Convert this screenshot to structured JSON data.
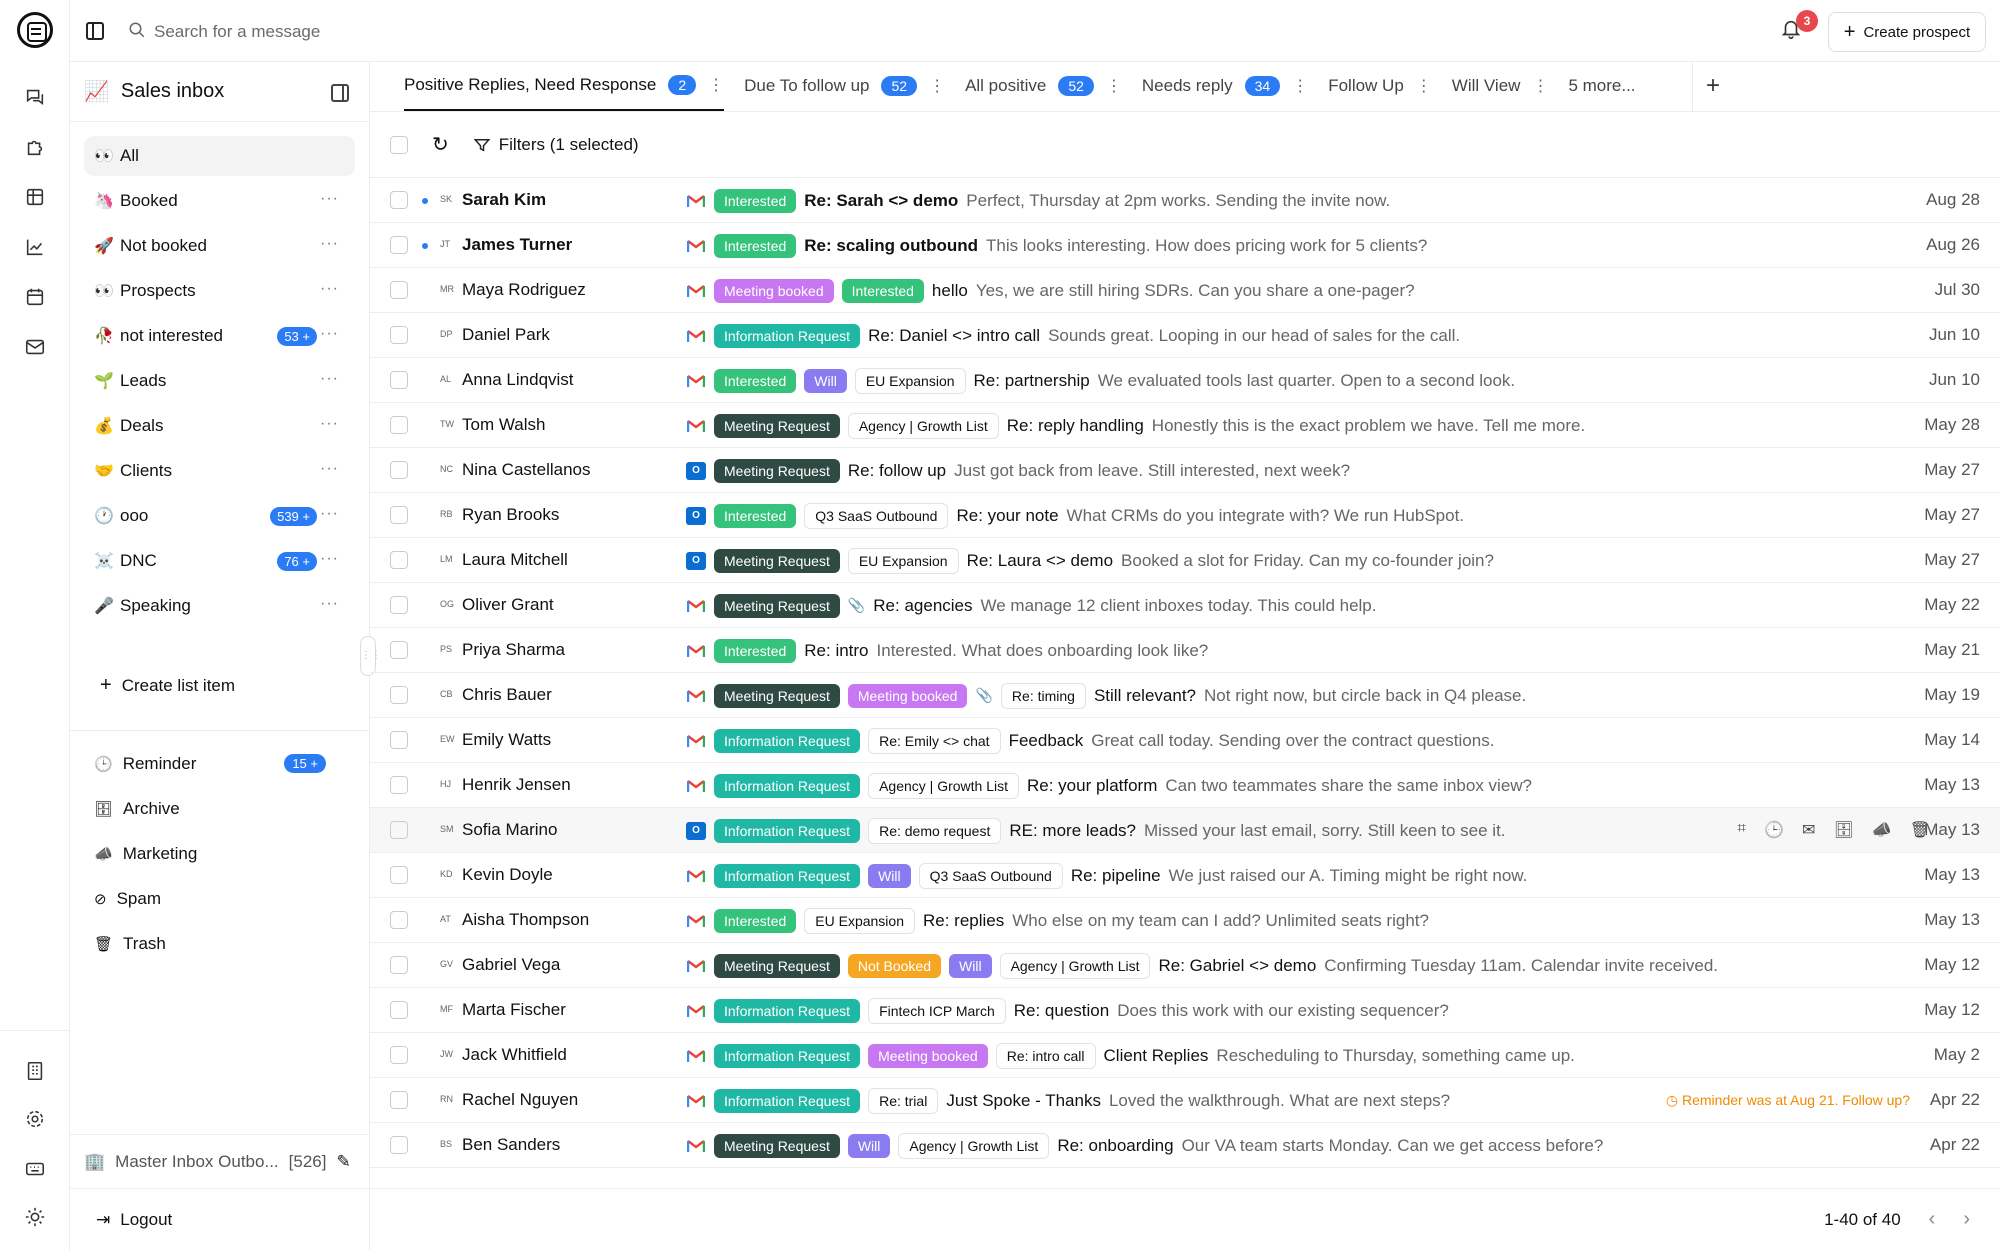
{
  "topbar": {
    "search_placeholder": "Search for a message",
    "notification_count": "3",
    "create_prospect": "Create prospect"
  },
  "sidebar": {
    "title": "Sales inbox",
    "title_emoji": "📈",
    "items": [
      {
        "emoji": "👀",
        "label": "All",
        "count": ""
      },
      {
        "emoji": "🦄",
        "label": "Booked",
        "count": ""
      },
      {
        "emoji": "🚀",
        "label": "Not booked",
        "count": ""
      },
      {
        "emoji": "👀",
        "label": "Prospects",
        "count": ""
      },
      {
        "emoji": "🥀",
        "label": "not interested",
        "count": "53 +"
      },
      {
        "emoji": "🌱",
        "label": "Leads",
        "count": ""
      },
      {
        "emoji": "💰",
        "label": "Deals",
        "count": ""
      },
      {
        "emoji": "🤝",
        "label": "Clients",
        "count": ""
      },
      {
        "emoji": "🕐",
        "label": "ooo",
        "count": "539 +"
      },
      {
        "emoji": "☠️",
        "label": "DNC",
        "count": "76 +"
      },
      {
        "emoji": "🎤",
        "label": "Speaking",
        "count": ""
      }
    ],
    "create_list_item": "Create list item",
    "bottom": [
      {
        "icon": "clock-icon",
        "label": "Reminder",
        "count": "15 +"
      },
      {
        "icon": "archive-icon",
        "label": "Archive",
        "count": ""
      },
      {
        "icon": "megaphone-icon",
        "label": "Marketing",
        "count": ""
      },
      {
        "icon": "spam-icon",
        "label": "Spam",
        "count": ""
      },
      {
        "icon": "trash-icon",
        "label": "Trash",
        "count": ""
      }
    ],
    "master_inbox": "Master Inbox Outbo...",
    "master_count": "[526]",
    "logout": "Logout"
  },
  "tabs": [
    {
      "label": "Positive Replies, Need Response",
      "count": "2"
    },
    {
      "label": "Due To follow up",
      "count": "52"
    },
    {
      "label": "All positive",
      "count": "52"
    },
    {
      "label": "Needs reply",
      "count": "34"
    },
    {
      "label": "Follow Up",
      "count": ""
    },
    {
      "label": "Will View",
      "count": ""
    },
    {
      "label": "5 more...",
      "count": ""
    }
  ],
  "toolbar": {
    "filters": "Filters (1 selected)"
  },
  "rows": [
    {
      "ini": "SK",
      "name": "Sarah Kim",
      "unread": true,
      "prov": "gm",
      "tags": [
        [
          "int",
          "Interested"
        ]
      ],
      "labels": [],
      "subject": "Re: Sarah <> demo",
      "preview": "Perfect, Thursday at 2pm works. Sending the invite now.",
      "date": "Aug 28"
    },
    {
      "ini": "JT",
      "name": "James Turner",
      "unread": true,
      "prov": "gm",
      "tags": [
        [
          "int",
          "Interested"
        ]
      ],
      "labels": [],
      "subject": "Re: scaling outbound",
      "preview": "This looks interesting. How does pricing work for 5 clients?",
      "date": "Aug 26"
    },
    {
      "ini": "MR",
      "name": "Maya Rodriguez",
      "unread": false,
      "prov": "gm",
      "tags": [
        [
          "mb",
          "Meeting booked"
        ],
        [
          "int",
          "Interested"
        ]
      ],
      "labels": [],
      "subject": "hello",
      "preview": "Yes, we are still hiring SDRs. Can you share a one-pager?",
      "date": "Jul 30"
    },
    {
      "ini": "DP",
      "name": "Daniel Park",
      "unread": false,
      "prov": "gm",
      "tags": [
        [
          "ir",
          "Information Request"
        ]
      ],
      "labels": [],
      "subject": "Re: Daniel <> intro call",
      "preview": "Sounds great. Looping in our head of sales for the call.",
      "date": "Jun 10"
    },
    {
      "ini": "AL",
      "name": "Anna Lindqvist",
      "unread": false,
      "prov": "gm",
      "tags": [
        [
          "int",
          "Interested"
        ],
        [
          "will",
          "Will"
        ]
      ],
      "labels": [
        "EU Expansion"
      ],
      "subject": "Re: partnership",
      "preview": "We evaluated tools last quarter. Open to a second look.",
      "date": "Jun 10"
    },
    {
      "ini": "TW",
      "name": "Tom Walsh",
      "unread": false,
      "prov": "gm",
      "tags": [
        [
          "mr",
          "Meeting Request"
        ]
      ],
      "labels": [
        "Agency | Growth List"
      ],
      "subject": "Re: reply handling",
      "preview": "Honestly this is the exact problem we have. Tell me more.",
      "date": "May 28"
    },
    {
      "ini": "NC",
      "name": "Nina Castellanos",
      "unread": false,
      "prov": "ol",
      "tags": [
        [
          "mr",
          "Meeting Request"
        ]
      ],
      "labels": [],
      "subject": "Re: follow up",
      "preview": "Just got back from leave. Still interested, next week?",
      "date": "May 27"
    },
    {
      "ini": "RB",
      "name": "Ryan Brooks",
      "unread": false,
      "prov": "ol",
      "tags": [
        [
          "int",
          "Interested"
        ]
      ],
      "labels": [
        "Q3 SaaS Outbound"
      ],
      "subject": "Re: your note",
      "preview": "What CRMs do you integrate with? We run HubSpot.",
      "date": "May 27"
    },
    {
      "ini": "LM",
      "name": "Laura Mitchell",
      "unread": false,
      "prov": "ol",
      "tags": [
        [
          "mr",
          "Meeting Request"
        ]
      ],
      "labels": [
        "EU Expansion"
      ],
      "subject": "Re: Laura <> demo",
      "preview": "Booked a slot for Friday. Can my co-founder join?",
      "date": "May 27"
    },
    {
      "ini": "OG",
      "name": "Oliver Grant",
      "unread": false,
      "prov": "gm",
      "tags": [
        [
          "mr",
          "Meeting Request"
        ]
      ],
      "labels": [],
      "clip": true,
      "subject": "Re: agencies",
      "preview": "We manage 12 client inboxes today. This could help.",
      "date": "May 22"
    },
    {
      "ini": "PS",
      "name": "Priya Sharma",
      "unread": false,
      "prov": "gm",
      "tags": [
        [
          "int",
          "Interested"
        ]
      ],
      "labels": [],
      "subject": "Re: intro",
      "preview": "Interested. What does onboarding look like?",
      "date": "May 21"
    },
    {
      "ini": "CB",
      "name": "Chris Bauer",
      "unread": false,
      "prov": "gm",
      "tags": [
        [
          "mr",
          "Meeting Request"
        ],
        [
          "mb",
          "Meeting booked"
        ]
      ],
      "labels": [],
      "clip": true,
      "thread": "Re: timing",
      "subject": "Still relevant?",
      "preview": "Not right now, but circle back in Q4 please.",
      "date": "May 19"
    },
    {
      "ini": "EW",
      "name": "Emily Watts",
      "unread": false,
      "prov": "gm",
      "tags": [
        [
          "ir",
          "Information Request"
        ]
      ],
      "labels": [
        "Re: Emily <> chat"
      ],
      "subject": "Feedback",
      "preview": "Great call today. Sending over the contract questions.",
      "date": "May 14"
    },
    {
      "ini": "HJ",
      "name": "Henrik Jensen",
      "unread": false,
      "prov": "gm",
      "tags": [
        [
          "ir",
          "Information Request"
        ]
      ],
      "labels": [
        "Agency | Growth List"
      ],
      "subject": "Re: your platform",
      "preview": "Can two teammates share the same inbox view?",
      "date": "May 13"
    },
    {
      "ini": "SM",
      "name": "Sofia Marino",
      "unread": false,
      "prov": "ol",
      "hover": true,
      "tags": [
        [
          "ir",
          "Information Request"
        ]
      ],
      "labels": [
        "Re: demo request"
      ],
      "subject": "RE: more leads?",
      "preview": "Missed your last email, sorry. Still keen to see it.",
      "date": "May 13"
    },
    {
      "ini": "KD",
      "name": "Kevin Doyle",
      "unread": false,
      "prov": "gm",
      "tags": [
        [
          "ir",
          "Information Request"
        ],
        [
          "will",
          "Will"
        ]
      ],
      "labels": [
        "Q3 SaaS Outbound"
      ],
      "subject": "Re: pipeline",
      "preview": "We just raised our A. Timing might be right now.",
      "date": "May 13"
    },
    {
      "ini": "AT",
      "name": "Aisha Thompson",
      "unread": false,
      "prov": "gm",
      "tags": [
        [
          "int",
          "Interested"
        ]
      ],
      "labels": [
        "EU Expansion"
      ],
      "subject": "Re: replies",
      "preview": "Who else on my team can I add? Unlimited seats right?",
      "date": "May 13"
    },
    {
      "ini": "GV",
      "name": "Gabriel Vega",
      "unread": false,
      "prov": "gm",
      "tags": [
        [
          "mr",
          "Meeting Request"
        ],
        [
          "nb",
          "Not Booked"
        ],
        [
          "will",
          "Will"
        ]
      ],
      "labels": [
        "Agency | Growth List"
      ],
      "subject": "Re: Gabriel <> demo",
      "preview": "Confirming Tuesday 11am. Calendar invite received.",
      "date": "May 12"
    },
    {
      "ini": "MF",
      "name": "Marta Fischer",
      "unread": false,
      "prov": "gm",
      "tags": [
        [
          "ir",
          "Information Request"
        ]
      ],
      "labels": [
        "Fintech ICP March"
      ],
      "subject": "Re: question",
      "preview": "Does this work with our existing sequencer?",
      "date": "May 12"
    },
    {
      "ini": "JW",
      "name": "Jack Whitfield",
      "unread": false,
      "prov": "gm",
      "tags": [
        [
          "ir",
          "Information Request"
        ],
        [
          "mb",
          "Meeting booked"
        ]
      ],
      "labels": [
        "Re: intro call"
      ],
      "subject": "Client Replies",
      "preview": "Rescheduling to Thursday, something came up.",
      "date": "May 2"
    },
    {
      "ini": "RN",
      "name": "Rachel Nguyen",
      "unread": false,
      "prov": "gm",
      "tags": [
        [
          "ir",
          "Information Request"
        ]
      ],
      "labels": [
        "Re: trial"
      ],
      "subject": "Just Spoke - Thanks",
      "preview": "Loved the walkthrough. What are next steps?",
      "date": "Apr 22",
      "reminder": "Reminder was at Aug 21. Follow up?"
    },
    {
      "ini": "BS",
      "name": "Ben Sanders",
      "unread": false,
      "prov": "gm",
      "tags": [
        [
          "mr",
          "Meeting Request"
        ],
        [
          "will",
          "Will"
        ]
      ],
      "labels": [
        "Agency | Growth List"
      ],
      "subject": "Re: onboarding",
      "preview": "Our VA team starts Monday. Can we get access before?",
      "date": "Apr 22"
    }
  ],
  "pagination": {
    "range": "1-40 of 40"
  }
}
